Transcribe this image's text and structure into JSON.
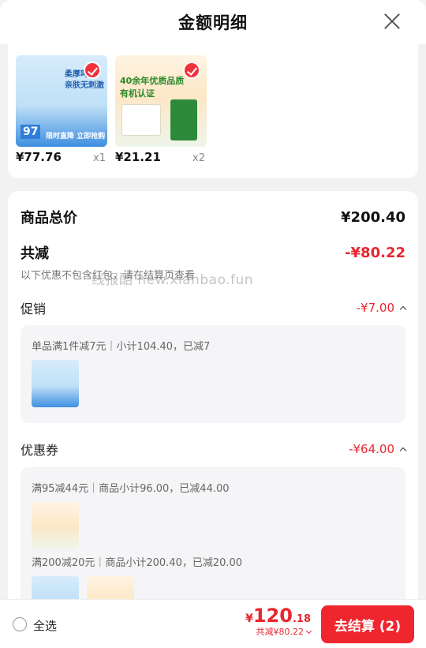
{
  "header": {
    "title": "金额明细"
  },
  "items": [
    {
      "price": "¥77.76",
      "qty": "x1",
      "pkg_text_1": "柔厚呵护",
      "pkg_text_2": "亲肤无刺激",
      "badge": "97",
      "promo": "限时直降 立即抢购"
    },
    {
      "price": "¥21.21",
      "qty": "x2",
      "pkg_text_1": "40余年优质品质",
      "pkg_text_2": "有机认证"
    }
  ],
  "summary": {
    "total_label": "商品总价",
    "total_value": "¥200.40",
    "discount_label": "共减",
    "discount_value": "-¥80.22",
    "note": "以下优惠不包含红包，请在结算页查看"
  },
  "promotion": {
    "label": "促销",
    "value": "-¥7.00",
    "detail": "单品满1件减7元｜小计104.40，已减7"
  },
  "coupon": {
    "label": "优惠券",
    "value": "-¥64.00",
    "detail_1": "满95减44元｜商品小计96.00，已减44.00",
    "detail_2": "满200减20元｜商品小计200.40，已减20.00"
  },
  "watermark": "线报酷 new.xianbao.fun",
  "footer": {
    "select_all": "全选",
    "currency": "¥",
    "total_int": "120",
    "total_dec": ".18",
    "total_discount": "共减¥80.22",
    "checkout": "去结算 (2)"
  },
  "colors": {
    "accent": "#f0262f",
    "discount": "#e8262f"
  }
}
